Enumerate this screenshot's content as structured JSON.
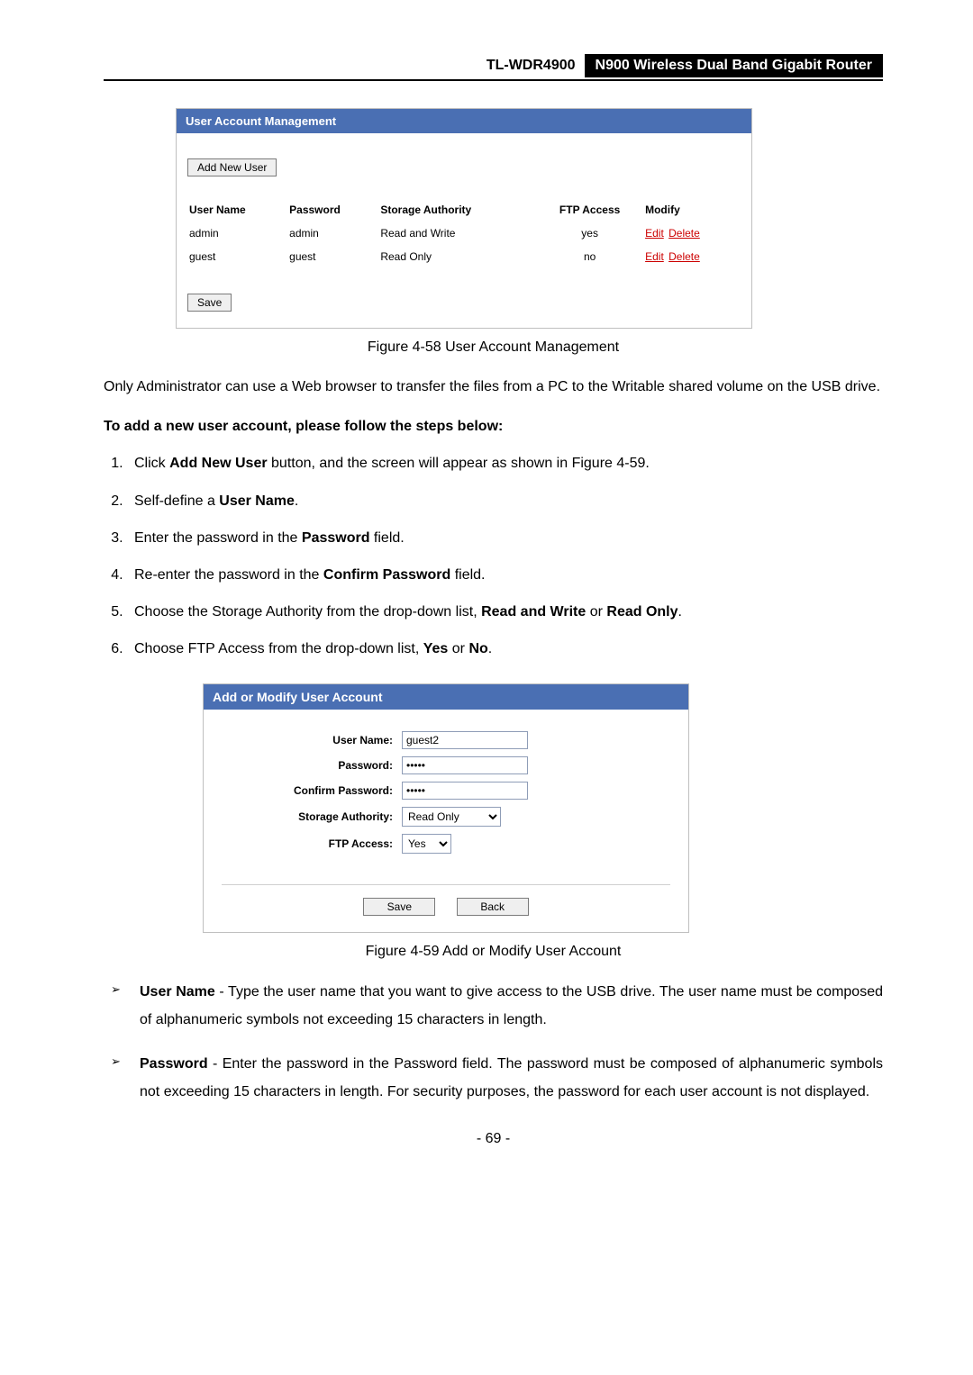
{
  "header": {
    "model": "TL-WDR4900",
    "product": "N900 Wireless Dual Band Gigabit Router"
  },
  "fig58": {
    "title": "User Account Management",
    "add_new_user": "Add New User",
    "columns": {
      "user_name": "User Name",
      "password": "Password",
      "storage_authority": "Storage Authority",
      "ftp_access": "FTP Access",
      "modify": "Modify"
    },
    "rows": [
      {
        "user": "admin",
        "password": "admin",
        "authority": "Read and Write",
        "ftp": "yes"
      },
      {
        "user": "guest",
        "password": "guest",
        "authority": "Read Only",
        "ftp": "no"
      }
    ],
    "actions": {
      "edit": "Edit",
      "delete": "Delete"
    },
    "save": "Save",
    "caption": "Figure 4-58 User Account Management"
  },
  "intro_para": "Only Administrator can use a Web browser to transfer the files from a PC to the Writable shared volume on the USB drive.",
  "steps_heading": "To add a new user account, please follow the steps below:",
  "steps": [
    {
      "pre": "Click ",
      "b": "Add New User",
      "post": " button, and the screen will appear as shown in Figure 4-59."
    },
    {
      "pre": "Self-define a ",
      "b": "User Name",
      "post": "."
    },
    {
      "pre": "Enter the password in the ",
      "b": "Password",
      "post": " field."
    },
    {
      "pre": "Re-enter the password in the ",
      "b": "Confirm Password",
      "post": " field."
    },
    {
      "pre": "Choose the Storage Authority from the drop-down list, ",
      "b": "Read and Write",
      "mid": " or ",
      "b2": "Read Only",
      "post": "."
    },
    {
      "pre": "Choose FTP Access from the drop-down list, ",
      "b": "Yes",
      "mid": " or ",
      "b2": "No",
      "post": "."
    }
  ],
  "fig59": {
    "title": "Add or Modify User Account",
    "labels": {
      "user_name": "User Name:",
      "password": "Password:",
      "confirm": "Confirm Password:",
      "storage": "Storage Authority:",
      "ftp": "FTP Access:"
    },
    "values": {
      "user_name": "guest2",
      "password": "•••••",
      "confirm": "•••••",
      "storage": "Read Only",
      "ftp": "Yes"
    },
    "save": "Save",
    "back": "Back",
    "caption": "Figure 4-59 Add or Modify User Account"
  },
  "bullets": [
    {
      "b": "User Name",
      "text": " - Type the user name that you want to give access to the USB drive. The user name must be composed of alphanumeric symbols not exceeding 15 characters in length."
    },
    {
      "b": "Password",
      "text": " - Enter the password in the Password field. The password must be composed of alphanumeric symbols not exceeding 15 characters in length. For security purposes, the password for each user account is not displayed."
    }
  ],
  "page_number": "- 69 -"
}
